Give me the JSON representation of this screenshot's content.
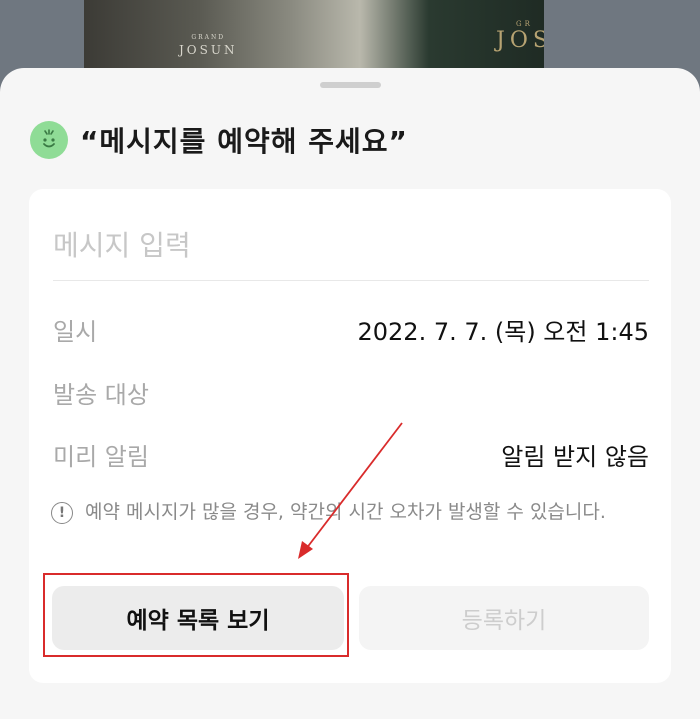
{
  "background": {
    "brand_left_small": "GRAND",
    "brand_left": "JOSUN",
    "brand_right_small": "GR",
    "brand_right": "JOS"
  },
  "dialog": {
    "title": "“메시지를 예약해 주세요”",
    "message_placeholder": "메시지 입력",
    "rows": [
      {
        "label": "일시",
        "value": "2022. 7. 7. (목) 오전 1:45"
      },
      {
        "label": "발송 대상",
        "value": ""
      },
      {
        "label": "미리 알림",
        "value": "알림 받지 않음"
      }
    ],
    "notice_icon": "!",
    "notice": "예약 메시지가 많을 경우, 약간의 시간 오차가 발생할 수 있습니다.",
    "buttons": {
      "view_list": "예약 목록 보기",
      "register": "등록하기"
    }
  },
  "colors": {
    "avatar_bg": "#8fdc96",
    "annotation": "#d92b2b"
  },
  "icons": [
    "avatar-face-icon",
    "info-icon"
  ]
}
